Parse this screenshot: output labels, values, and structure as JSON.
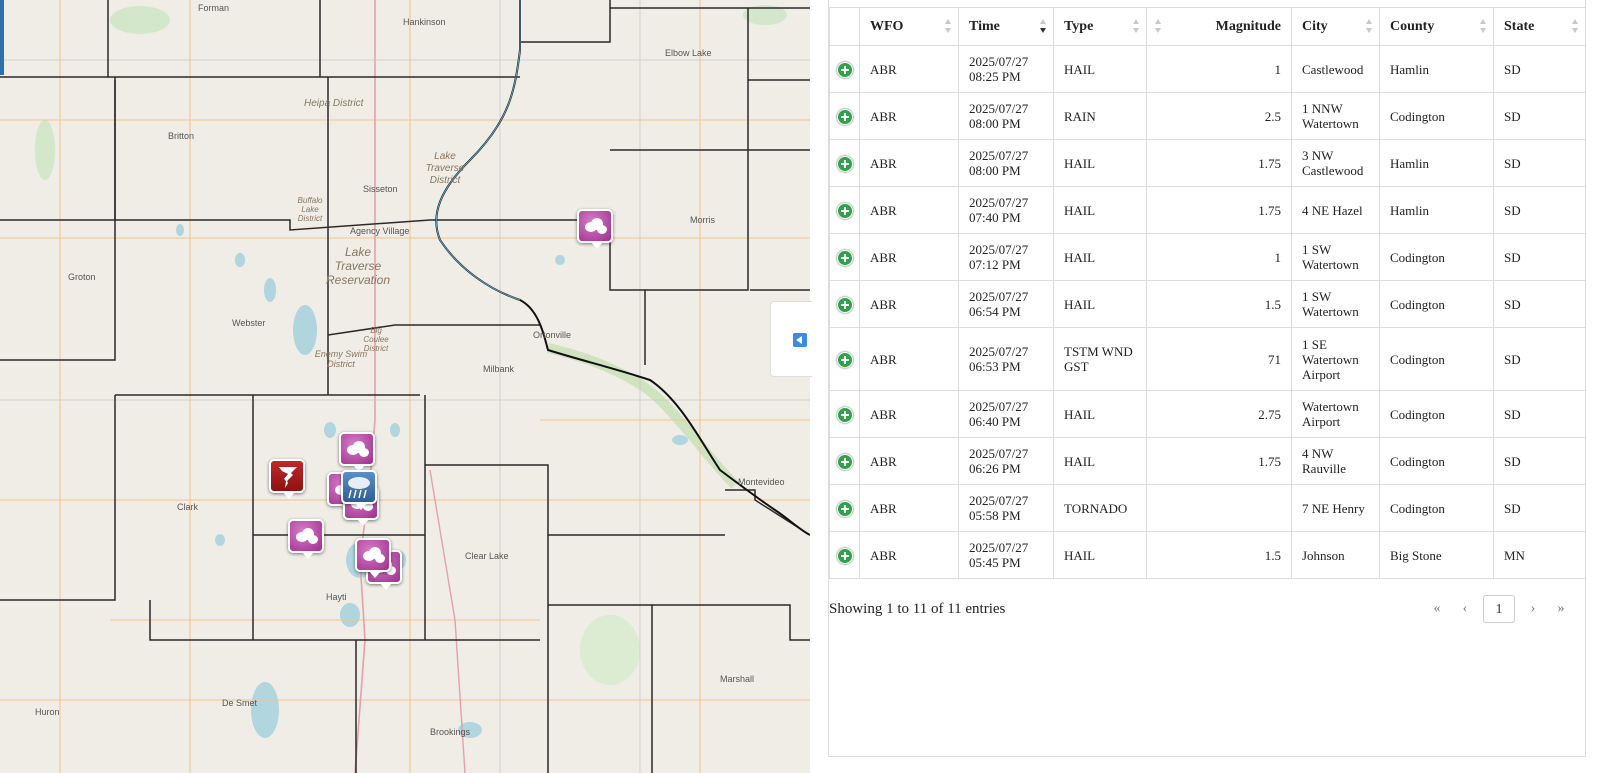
{
  "map": {
    "places": [
      "Forman",
      "Hankinson",
      "Elbow Lake",
      "Britton",
      "Sisseton",
      "Agency Village",
      "Morris",
      "Groton",
      "Webster",
      "Ortonville",
      "Milbank",
      "Clark",
      "Clear Lake",
      "Hayti",
      "Marshall",
      "Huron",
      "De Smet",
      "Brookings",
      "Montevideo"
    ],
    "areas": [
      "Heipa District",
      "Lake Traverse District",
      "Buffalo Lake District",
      "Lake Traverse Reservation",
      "Big Coulee District",
      "Enemy Swim District"
    ],
    "marker_icons": [
      "hail-cloud-icon",
      "tornado-icon",
      "rain-icon"
    ],
    "colors": {
      "hail": "#b0489e",
      "tornado": "#b01c1d",
      "rain": "#3f76b5"
    }
  },
  "panel_toggle_icon": "collapse-left-arrow-icon",
  "table": {
    "columns": [
      "",
      "WFO",
      "Time",
      "Type",
      "Magnitude",
      "City",
      "County",
      "State"
    ],
    "rows": [
      {
        "wfo": "ABR",
        "date": "2025/07/27",
        "time": "08:25 PM",
        "type": "HAIL",
        "mag": "1",
        "city": "Castlewood",
        "county": "Hamlin",
        "state": "SD"
      },
      {
        "wfo": "ABR",
        "date": "2025/07/27",
        "time": "08:00 PM",
        "type": "RAIN",
        "mag": "2.5",
        "city": "1 NNW Watertown",
        "county": "Codington",
        "state": "SD"
      },
      {
        "wfo": "ABR",
        "date": "2025/07/27",
        "time": "08:00 PM",
        "type": "HAIL",
        "mag": "1.75",
        "city": "3 NW Castlewood",
        "county": "Hamlin",
        "state": "SD"
      },
      {
        "wfo": "ABR",
        "date": "2025/07/27",
        "time": "07:40 PM",
        "type": "HAIL",
        "mag": "1.75",
        "city": "4 NE Hazel",
        "county": "Hamlin",
        "state": "SD"
      },
      {
        "wfo": "ABR",
        "date": "2025/07/27",
        "time": "07:12 PM",
        "type": "HAIL",
        "mag": "1",
        "city": "1 SW Watertown",
        "county": "Codington",
        "state": "SD"
      },
      {
        "wfo": "ABR",
        "date": "2025/07/27",
        "time": "06:54 PM",
        "type": "HAIL",
        "mag": "1.5",
        "city": "1 SW Watertown",
        "county": "Codington",
        "state": "SD"
      },
      {
        "wfo": "ABR",
        "date": "2025/07/27",
        "time": "06:53 PM",
        "type": "TSTM WND GST",
        "mag": "71",
        "city": "1 SE Watertown Airport",
        "county": "Codington",
        "state": "SD"
      },
      {
        "wfo": "ABR",
        "date": "2025/07/27",
        "time": "06:40 PM",
        "type": "HAIL",
        "mag": "2.75",
        "city": "Watertown Airport",
        "county": "Codington",
        "state": "SD"
      },
      {
        "wfo": "ABR",
        "date": "2025/07/27",
        "time": "06:26 PM",
        "type": "HAIL",
        "mag": "1.75",
        "city": "4 NW Rauville",
        "county": "Codington",
        "state": "SD"
      },
      {
        "wfo": "ABR",
        "date": "2025/07/27",
        "time": "05:58 PM",
        "type": "TORNADO",
        "mag": "",
        "city": "7 NE Henry",
        "county": "Codington",
        "state": "SD"
      },
      {
        "wfo": "ABR",
        "date": "2025/07/27",
        "time": "05:45 PM",
        "type": "HAIL",
        "mag": "1.5",
        "city": "Johnson",
        "county": "Big Stone",
        "state": "MN"
      }
    ],
    "expand_icon": "plus-circle-icon",
    "sort_column": "Time",
    "sort_direction": "descending"
  },
  "info": "Showing 1 to 11 of 11 entries",
  "pager": {
    "first": "«",
    "prev": "‹",
    "current": "1",
    "next": "›",
    "last": "»"
  }
}
